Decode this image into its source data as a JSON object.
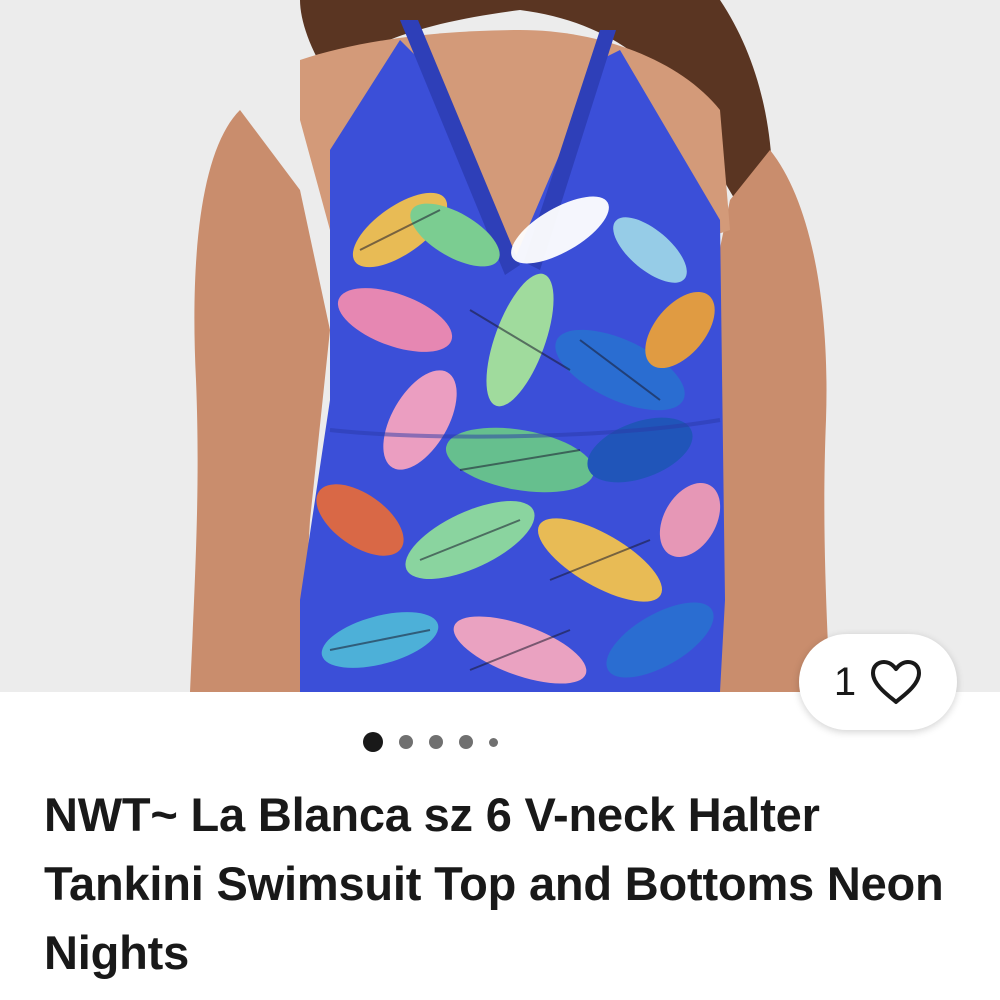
{
  "listing": {
    "title": "NWT~ La Blanca sz 6 V-neck Halter Tankini Swimsuit Top and Bottoms Neon Nights"
  },
  "like": {
    "count": "1",
    "icon": "heart-outline-icon"
  },
  "carousel": {
    "total_images": 5,
    "active_index": 0
  },
  "colors": {
    "text": "#191919",
    "photo_background": "#ececec",
    "dot_active": "#191919",
    "dot_inactive": "#707070",
    "swimsuit_base": "#3b4fd8"
  }
}
